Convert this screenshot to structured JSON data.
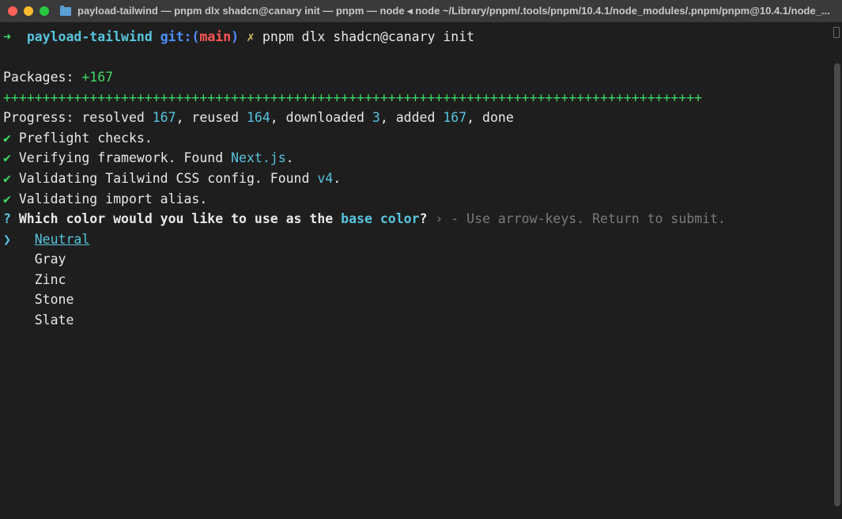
{
  "titlebar": {
    "window_title": "payload-tailwind — pnpm dlx shadcn@canary init — pnpm — node ◂ node ~/Library/pnpm/.tools/pnpm/10.4.1/node_modules/.pnpm/pnpm@10.4.1/node_..."
  },
  "prompt": {
    "arrow": "➜",
    "folder": "payload-tailwind",
    "git_label": "git:",
    "branch": "main",
    "x": "✗",
    "command": "pnpm dlx shadcn@canary init"
  },
  "output": {
    "packages_label": "Packages: ",
    "packages_count": "+167",
    "plus_row": "+++++++++++++++++++++++++++++++++++++++++++++++++++++++++++++++++++++++++++++++++++++++++",
    "progress": {
      "prefix": "Progress: resolved ",
      "resolved": "167",
      "reused_label": ", reused ",
      "reused": "164",
      "downloaded_label": ", downloaded ",
      "downloaded": "3",
      "added_label": ", added ",
      "added": "167",
      "done": ", done"
    },
    "checks": {
      "mark": "✔",
      "preflight": " Preflight checks.",
      "verify_framework": " Verifying framework. Found ",
      "framework": "Next.js",
      "period1": ".",
      "validating_tailwind": " Validating Tailwind CSS config. Found ",
      "tailwind_version": "v4",
      "period2": ".",
      "import_alias": " Validating import alias."
    },
    "prompt_question": {
      "mark": "?",
      "text_part": " Which color would you like to use as the ",
      "base_color": "base color",
      "question_mark": "?",
      "hint_arrow": " › ",
      "hint_dash": "- ",
      "hint_text": "Use arrow-keys. Return to submit."
    },
    "selector_arrow": "❯",
    "options": {
      "selected": "Neutral",
      "opt1": "Gray",
      "opt2": "Zinc",
      "opt3": "Stone",
      "opt4": "Slate"
    }
  }
}
